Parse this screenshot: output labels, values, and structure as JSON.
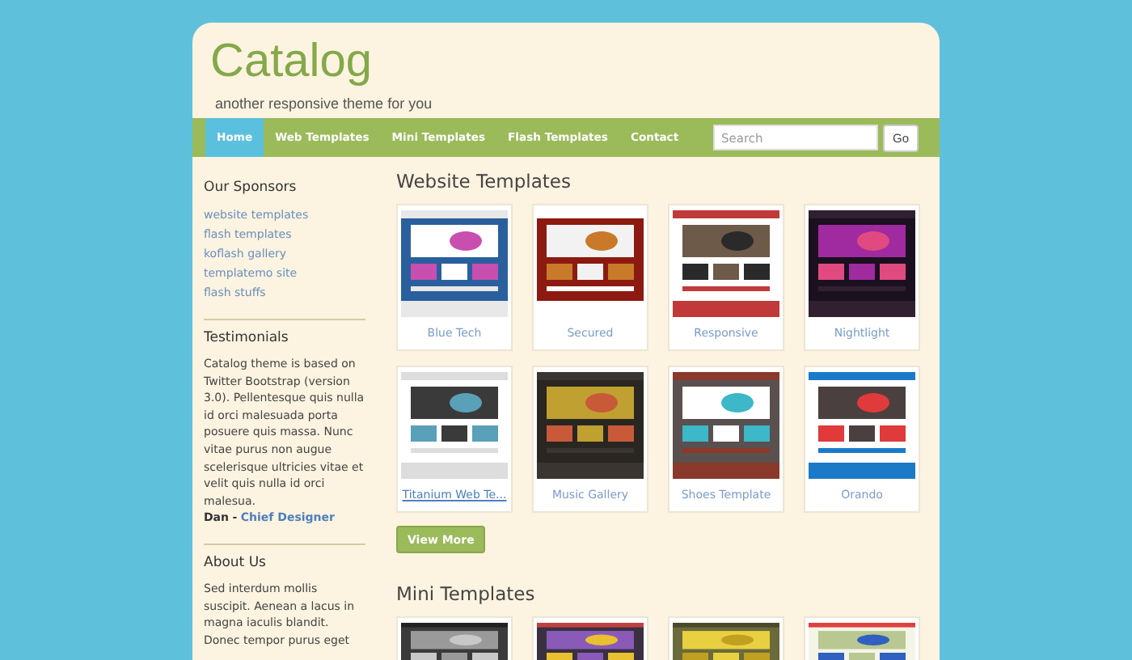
{
  "header": {
    "title": "Catalog",
    "tagline": "another responsive theme for you"
  },
  "nav": {
    "items": [
      {
        "label": "Home",
        "selected": true
      },
      {
        "label": "Web Templates",
        "selected": false
      },
      {
        "label": "Mini Templates",
        "selected": false
      },
      {
        "label": "Flash Templates",
        "selected": false
      },
      {
        "label": "Contact",
        "selected": false
      }
    ],
    "search": {
      "placeholder": "Search"
    },
    "go_button": "Go"
  },
  "sidebar": {
    "sponsors": {
      "title": "Our Sponsors",
      "links": [
        "website templates",
        "flash templates",
        "koflash gallery",
        "templatemo site",
        "flash stuffs"
      ]
    },
    "testimonials": {
      "title": "Testimonials",
      "text": "Catalog theme is based on Twitter Bootstrap (version 3.0). Pellentesque quis nulla id orci malesuada porta posuere quis massa. Nunc vitae purus non augue scelerisque ultricies vitae et velit quis nulla id orci malesua.",
      "author": "Dan",
      "separator": "-",
      "role": "Chief Designer"
    },
    "about": {
      "title": "About Us",
      "text": "Sed interdum mollis suscipit. Aenean a lacus in magna iaculis blandit. Donec tempor purus eget"
    }
  },
  "website_templates": {
    "title": "Website Templates",
    "items": [
      {
        "name": "Blue Tech",
        "hovered": false
      },
      {
        "name": "Secured",
        "hovered": false
      },
      {
        "name": "Responsive",
        "hovered": false
      },
      {
        "name": "Nightlight",
        "hovered": false
      },
      {
        "name": "Titanium Web Te...",
        "hovered": true
      },
      {
        "name": "Music Gallery",
        "hovered": false
      },
      {
        "name": "Shoes Template",
        "hovered": false
      },
      {
        "name": "Orando",
        "hovered": false
      }
    ],
    "view_more": "View More"
  },
  "mini_templates": {
    "title": "Mini Templates"
  }
}
